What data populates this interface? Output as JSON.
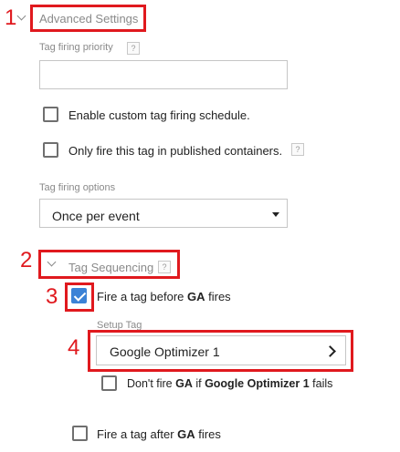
{
  "annotations": {
    "n1": "1",
    "n2": "2",
    "n3": "3",
    "n4": "4"
  },
  "advanced": {
    "title": "Advanced Settings",
    "priority_label": "Tag firing priority",
    "priority_help": "?",
    "priority_value": "",
    "custom_schedule_label": "Enable custom tag firing schedule.",
    "custom_schedule_checked": false,
    "published_only_label": "Only fire this tag in published containers.",
    "published_only_help": "?",
    "published_only_checked": false,
    "firing_options_label": "Tag firing options",
    "firing_options_value": "Once per event"
  },
  "sequencing": {
    "title": "Tag Sequencing",
    "help": "?",
    "fire_before_prefix": "Fire a tag before ",
    "fire_before_tag": "GA",
    "fire_before_suffix": " fires",
    "fire_before_checked": true,
    "setup_tag_label": "Setup Tag",
    "setup_tag_value": "Google Optimizer 1",
    "dont_fire_prefix": "Don't fire ",
    "dont_fire_tag": "GA",
    "dont_fire_mid": " if ",
    "dont_fire_setup": "Google Optimizer 1",
    "dont_fire_suffix": " fails",
    "dont_fire_checked": false,
    "fire_after_prefix": "Fire a tag after ",
    "fire_after_tag": "GA",
    "fire_after_suffix": " fires",
    "fire_after_checked": false
  },
  "colors": {
    "annotation": "#e0191e",
    "check_blue": "#3b82d6"
  },
  "icons": {
    "section_toggle": "chevron-down-icon",
    "help": "help-icon",
    "select_arrow": "dropdown-arrow-icon",
    "setup_tag_open": "chevron-right-icon",
    "check": "checkmark-icon"
  }
}
